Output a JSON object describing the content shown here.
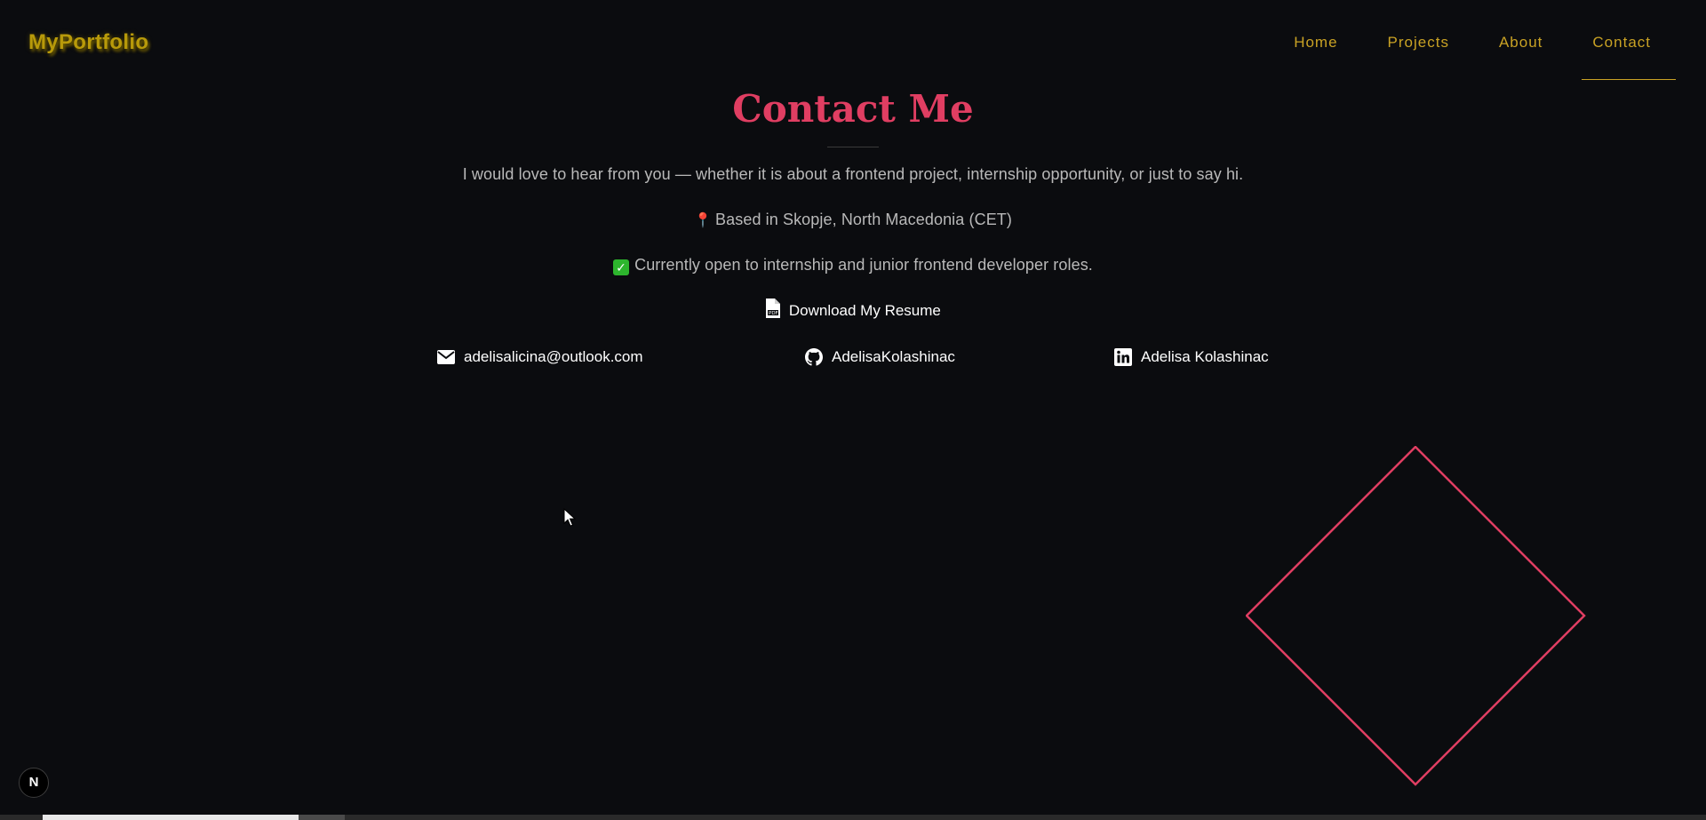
{
  "navbar": {
    "logo": "MyPortfolio",
    "links": [
      {
        "label": "Home"
      },
      {
        "label": "Projects"
      },
      {
        "label": "About"
      },
      {
        "label": "Contact",
        "active": true
      }
    ]
  },
  "contact": {
    "title": "Contact Me",
    "intro": "I would love to hear from you — whether it is about a frontend project, internship opportunity, or just to say hi.",
    "location_icon": "pin-icon",
    "location": "Based in Skopje, North Macedonia (CET)",
    "availability_icon": "check-icon",
    "availability": "Currently open to internship and junior frontend developer roles.",
    "resume_icon": "pdf-file-icon",
    "resume_label": "Download My Resume",
    "links": [
      {
        "icon": "envelope-icon",
        "label": "adelisalicina@outlook.com"
      },
      {
        "icon": "github-icon",
        "label": "AdelisaKolashinac"
      },
      {
        "icon": "linkedin-icon",
        "label": "Adelisa Kolashinac"
      }
    ]
  },
  "dev_badge": {
    "label": "N"
  },
  "colors": {
    "background": "#0b0c0f",
    "accent_gold": "#c9a224",
    "accent_pink": "#e03e62",
    "text_muted": "#b9b9b9"
  }
}
